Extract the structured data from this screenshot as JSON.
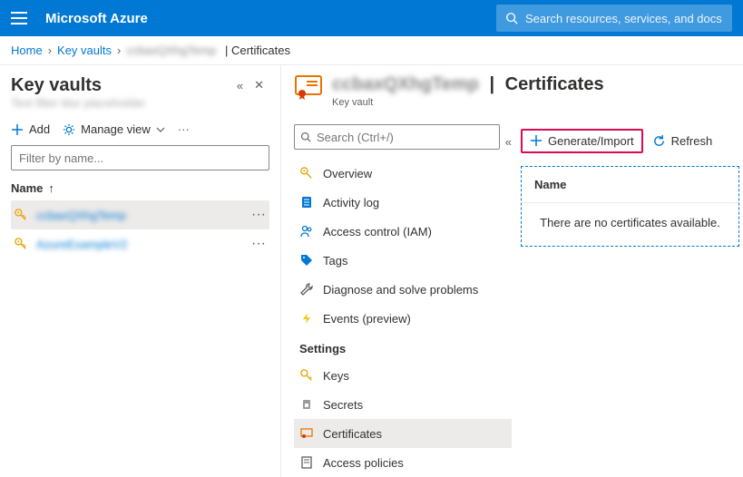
{
  "header": {
    "brand": "Microsoft Azure",
    "search_placeholder": "Search resources, services, and docs (G+/)"
  },
  "breadcrumb": {
    "home": "Home",
    "keyvaults": "Key vaults",
    "resource_name": "ccbaxQXhgTemp",
    "suffix": "Certificates"
  },
  "left": {
    "title": "Key vaults",
    "subtitle": "Text filter blur placeholder",
    "actions": {
      "add": "Add",
      "manage_view": "Manage view"
    },
    "filter_placeholder": "Filter by name...",
    "column_name": "Name",
    "rows": [
      {
        "name": "ccbaxQXhgTemp"
      },
      {
        "name": "AzureExampleV2"
      }
    ]
  },
  "detail": {
    "title_resource": "ccbaxQXhgTemp",
    "title_suffix": "Certificates",
    "subtitle": "Key vault",
    "search_placeholder": "Search (Ctrl+/)",
    "nav": {
      "overview": "Overview",
      "activity_log": "Activity log",
      "access_control": "Access control (IAM)",
      "tags": "Tags",
      "diagnose": "Diagnose and solve problems",
      "events": "Events (preview)",
      "group_settings": "Settings",
      "keys": "Keys",
      "secrets": "Secrets",
      "certificates": "Certificates",
      "access_policies": "Access policies"
    }
  },
  "content": {
    "generate": "Generate/Import",
    "refresh": "Refresh",
    "col_name": "Name",
    "empty": "There are no certificates available."
  }
}
